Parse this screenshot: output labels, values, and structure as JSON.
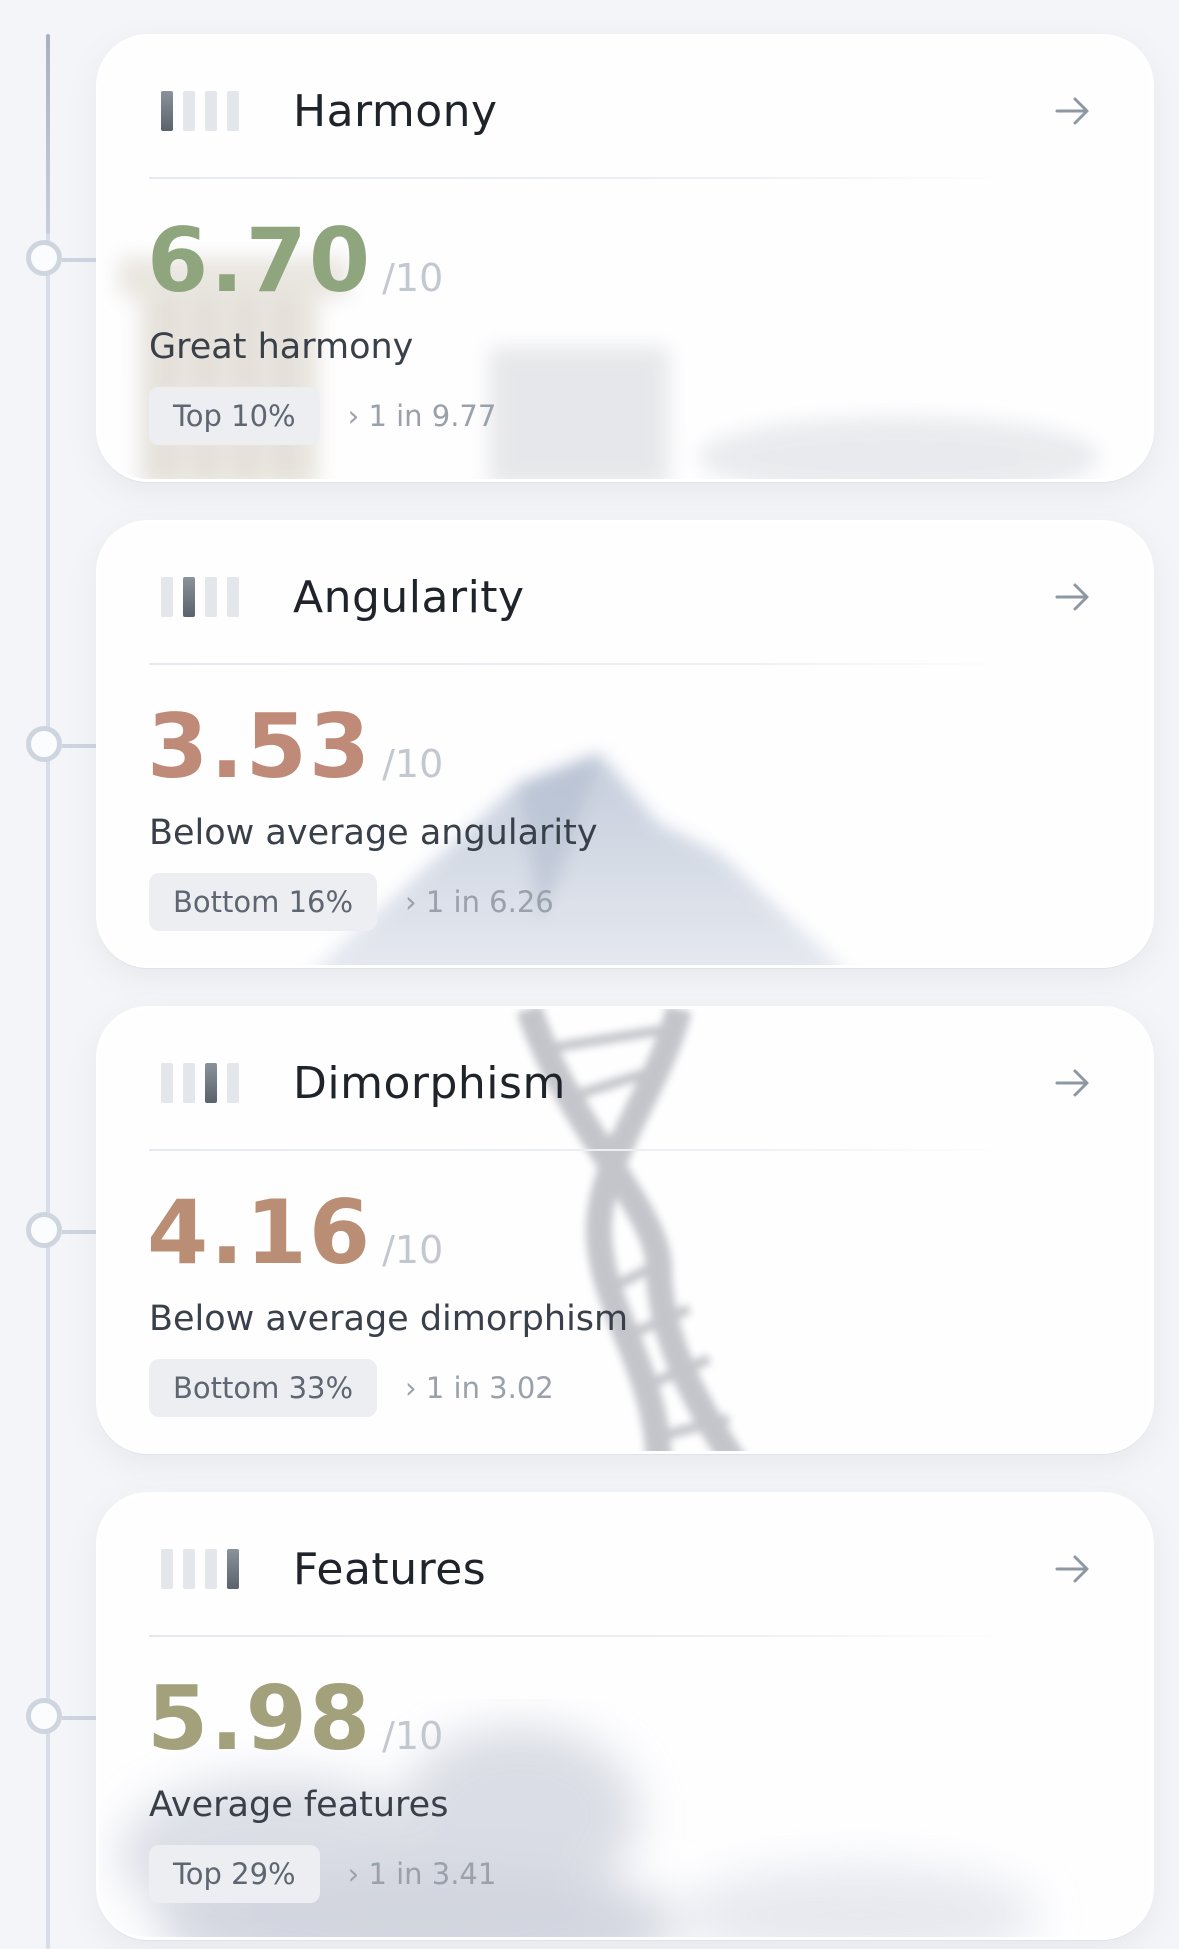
{
  "cards": [
    {
      "title": "Harmony",
      "score": "6.70",
      "denom": "/10",
      "description": "Great harmony",
      "percentile": "Top 10%",
      "ratio": "› 1 in 9.77",
      "score_color": "#8fa57e",
      "active_bar": 0,
      "background_theme": "greek-column"
    },
    {
      "title": "Angularity",
      "score": "3.53",
      "denom": "/10",
      "description": "Below average angularity",
      "percentile": "Bottom 16%",
      "ratio": "› 1 in 6.26",
      "score_color": "#bf8a78",
      "active_bar": 1,
      "background_theme": "mountain"
    },
    {
      "title": "Dimorphism",
      "score": "4.16",
      "denom": "/10",
      "description": "Below average dimorphism",
      "percentile": "Bottom 33%",
      "ratio": "› 1 in 3.02",
      "score_color": "#b98e74",
      "active_bar": 2,
      "background_theme": "dna-helix"
    },
    {
      "title": "Features",
      "score": "5.98",
      "denom": "/10",
      "description": "Average features",
      "percentile": "Top 29%",
      "ratio": "› 1 in 3.41",
      "score_color": "#a3a07c",
      "active_bar": 3,
      "background_theme": "clouds"
    }
  ]
}
